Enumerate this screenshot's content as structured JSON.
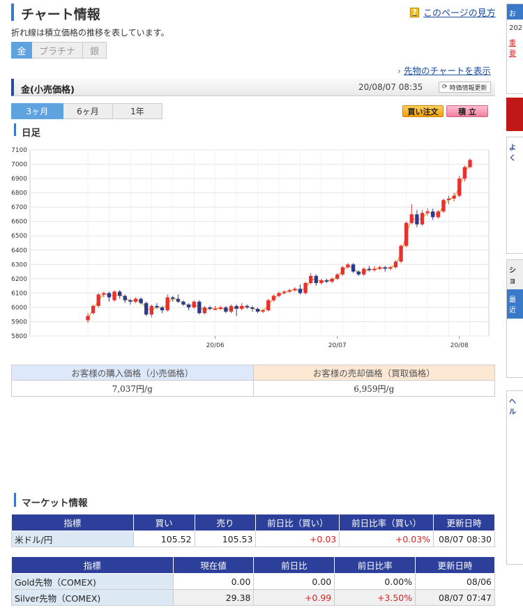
{
  "header": {
    "title": "チャート情報",
    "help_link": "このページの見方",
    "help_icon": "?"
  },
  "description": "折れ線は積立価格の推移を表しています。",
  "metal_tabs": [
    {
      "label": "金",
      "active": true
    },
    {
      "label": "プラチナ",
      "active": false
    },
    {
      "label": "銀",
      "active": false
    }
  ],
  "futures_link": "先物のチャートを表示",
  "price_bar": {
    "title": "金(小売価格)",
    "datetime": "20/08/07 08:35",
    "update_label": "時価情報更新"
  },
  "period_tabs": [
    {
      "label": "3ヶ月",
      "active": true
    },
    {
      "label": "6ヶ月",
      "active": false
    },
    {
      "label": "1年",
      "active": false
    }
  ],
  "buttons": {
    "buy": "買い注文",
    "accumulate": "積 立"
  },
  "chart_section_title": "日足",
  "chart_data": {
    "type": "candlestick",
    "x_ticks": [
      "20/06",
      "20/07",
      "20/08"
    ],
    "y_ticks": [
      5800,
      5900,
      6000,
      6100,
      6200,
      6300,
      6400,
      6500,
      6600,
      6700,
      6800,
      6900,
      7000,
      7100
    ],
    "ylim": [
      5800,
      7100
    ],
    "grid": true,
    "up_color": "#e83030",
    "down_color": "#2a3a8c",
    "line_color": "#f0a020",
    "candles": [
      [
        5910,
        5940,
        5960,
        5890
      ],
      [
        5960,
        6010,
        6020,
        5950
      ],
      [
        6010,
        6090,
        6100,
        6000
      ],
      [
        6090,
        6100,
        6110,
        6070
      ],
      [
        6100,
        6070,
        6110,
        6040
      ],
      [
        6050,
        6110,
        6120,
        6040
      ],
      [
        6110,
        6080,
        6120,
        6060
      ],
      [
        6080,
        6050,
        6090,
        6030
      ],
      [
        6050,
        6040,
        6060,
        6020
      ],
      [
        6040,
        6060,
        6070,
        6030
      ],
      [
        6060,
        6030,
        6070,
        6020
      ],
      [
        6030,
        5950,
        6040,
        5940
      ],
      [
        5950,
        6010,
        6020,
        5930
      ],
      [
        6010,
        6000,
        6030,
        5990
      ],
      [
        6000,
        5980,
        6010,
        5960
      ],
      [
        5980,
        6070,
        6090,
        5970
      ],
      [
        6070,
        6060,
        6080,
        6040
      ],
      [
        6060,
        6040,
        6090,
        6030
      ],
      [
        6040,
        6020,
        6050,
        6010
      ],
      [
        6020,
        6000,
        6030,
        5980
      ],
      [
        6000,
        6040,
        6050,
        5990
      ],
      [
        6040,
        5960,
        6050,
        5950
      ],
      [
        5960,
        6000,
        6010,
        5950
      ],
      [
        6000,
        5990,
        6010,
        5980
      ],
      [
        5990,
        5990,
        6010,
        5980
      ],
      [
        5990,
        6000,
        6010,
        5980
      ],
      [
        6000,
        5970,
        6010,
        5960
      ],
      [
        5970,
        6010,
        6020,
        5960
      ],
      [
        6010,
        5990,
        6020,
        5940
      ],
      [
        5990,
        6010,
        6030,
        5980
      ],
      [
        6010,
        6000,
        6020,
        5990
      ],
      [
        6000,
        5990,
        6010,
        5970
      ],
      [
        5990,
        5970,
        6000,
        5960
      ],
      [
        5970,
        5980,
        5990,
        5960
      ],
      [
        5980,
        6050,
        6060,
        5970
      ],
      [
        6050,
        6080,
        6090,
        6040
      ],
      [
        6080,
        6100,
        6110,
        6070
      ],
      [
        6100,
        6110,
        6120,
        6090
      ],
      [
        6110,
        6120,
        6130,
        6100
      ],
      [
        6120,
        6130,
        6140,
        6110
      ],
      [
        6130,
        6100,
        6160,
        6090
      ],
      [
        6100,
        6170,
        6180,
        6090
      ],
      [
        6170,
        6220,
        6240,
        6160
      ],
      [
        6220,
        6170,
        6230,
        6150
      ],
      [
        6170,
        6190,
        6200,
        6160
      ],
      [
        6190,
        6180,
        6200,
        6170
      ],
      [
        6180,
        6200,
        6210,
        6170
      ],
      [
        6200,
        6230,
        6240,
        6190
      ],
      [
        6230,
        6280,
        6290,
        6220
      ],
      [
        6280,
        6300,
        6310,
        6270
      ],
      [
        6300,
        6250,
        6310,
        6240
      ],
      [
        6250,
        6230,
        6260,
        6220
      ],
      [
        6230,
        6270,
        6280,
        6220
      ],
      [
        6270,
        6260,
        6290,
        6250
      ],
      [
        6260,
        6270,
        6290,
        6250
      ],
      [
        6270,
        6280,
        6290,
        6260
      ],
      [
        6280,
        6270,
        6290,
        6250
      ],
      [
        6270,
        6280,
        6290,
        6260
      ],
      [
        6280,
        6320,
        6330,
        6270
      ],
      [
        6320,
        6430,
        6440,
        6310
      ],
      [
        6430,
        6590,
        6600,
        6420
      ],
      [
        6590,
        6650,
        6720,
        6580
      ],
      [
        6650,
        6580,
        6680,
        6560
      ],
      [
        6580,
        6660,
        6680,
        6570
      ],
      [
        6660,
        6670,
        6690,
        6640
      ],
      [
        6670,
        6630,
        6690,
        6610
      ],
      [
        6630,
        6670,
        6680,
        6620
      ],
      [
        6670,
        6750,
        6760,
        6660
      ],
      [
        6750,
        6760,
        6780,
        6720
      ],
      [
        6760,
        6780,
        6800,
        6740
      ],
      [
        6780,
        6900,
        6920,
        6770
      ],
      [
        6900,
        6980,
        6990,
        6880
      ],
      [
        6980,
        7030,
        7040,
        6970
      ]
    ]
  },
  "price_table": {
    "buy_header": "お客様の購入価格（小売価格）",
    "sell_header": "お客様の売却価格（買取価格）",
    "buy_value": "7,037円/g",
    "sell_value": "6,959円/g"
  },
  "market_section_title": "マーケット情報",
  "market_table1": {
    "headers": [
      "指標",
      "買い",
      "売り",
      "前日比（買い）",
      "前日比率（買い）",
      "更新日時"
    ],
    "rows": [
      {
        "name": "米ドル/円",
        "buy": "105.52",
        "sell": "105.53",
        "change": "+0.03",
        "rate": "+0.03%",
        "updated": "08/07 08:30"
      }
    ]
  },
  "market_table2": {
    "headers": [
      "指標",
      "現在値",
      "前日比",
      "前日比率",
      "更新日時"
    ],
    "rows": [
      {
        "name": "Gold先物（COMEX)",
        "value": "0.00",
        "change": "0.00",
        "rate": "0.00%",
        "updated": "08/06"
      },
      {
        "name": "Silver先物（COMEX)",
        "value": "29.38",
        "change": "+0.99",
        "rate": "+3.50%",
        "updated": "08/07 07:47"
      }
    ]
  },
  "sidebar": {
    "news_label": "お知",
    "year": "202",
    "important": "重要",
    "faq": "よく",
    "shop": "ショ",
    "recent": "最近",
    "help": "ヘル"
  }
}
